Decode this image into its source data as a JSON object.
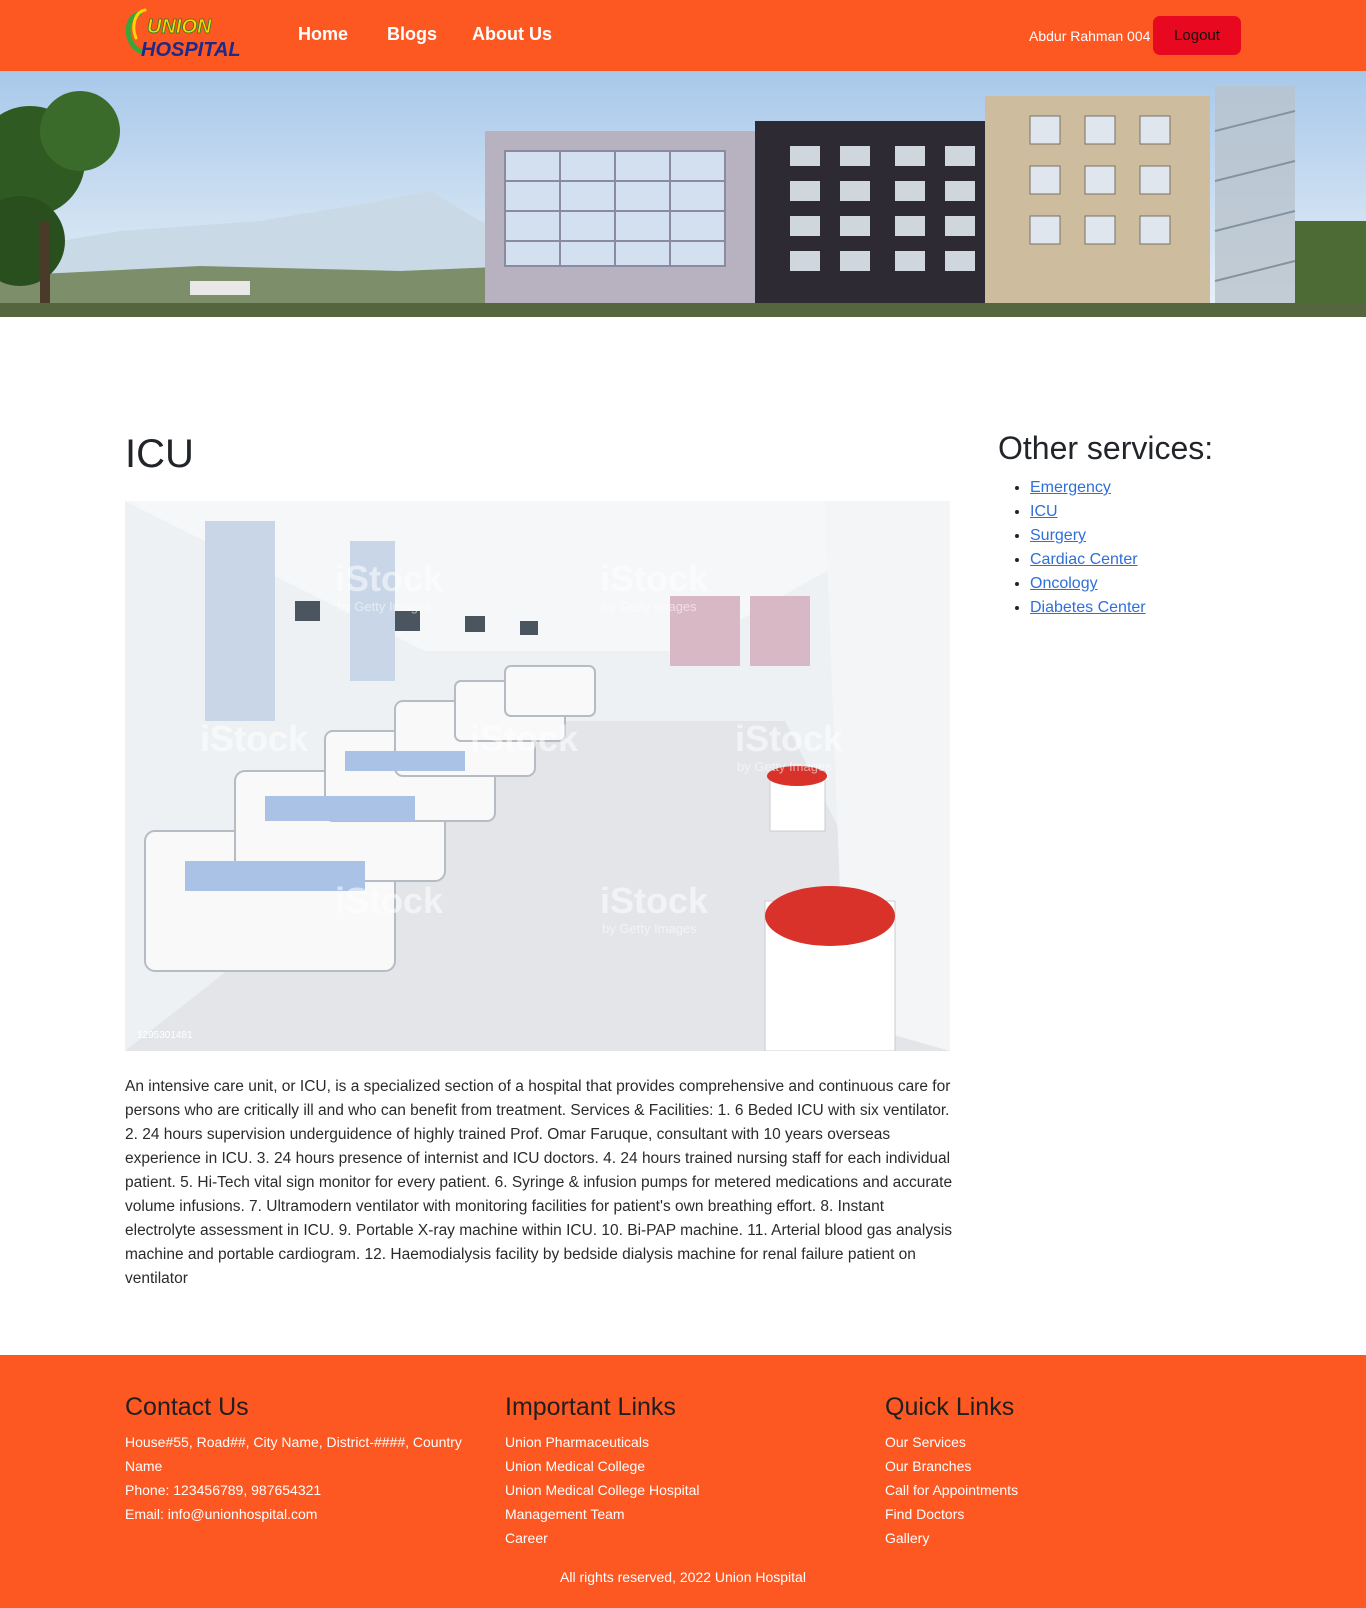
{
  "nav": {
    "logo_top": "UNION",
    "logo_bottom": "HOSPITAL",
    "links": [
      "Home",
      "Blogs",
      "About Us"
    ],
    "user_name": "Abdur Rahman 004",
    "logout_label": "Logout"
  },
  "main": {
    "title": "ICU",
    "image_watermark": "iStock",
    "image_watermark_sub": "by Getty Images",
    "image_id": "1295301481",
    "description": "An intensive care unit, or ICU, is a specialized section of a hospital that provides comprehensive and continuous care for persons who are critically ill and who can benefit from treatment. Services & Facilities: 1. 6 Beded ICU with six ventilator. 2. 24 hours supervision underguidence of highly trained Prof. Omar Faruque, consultant with 10 years overseas experience in ICU. 3. 24 hours presence of internist and ICU doctors. 4. 24 hours trained nursing staff for each individual patient. 5. Hi-Tech vital sign monitor for every patient. 6. Syringe & infusion pumps for metered medications and accurate volume infusions. 7. Ultramodern ventilator with monitoring facilities for patient's own breathing effort. 8. Instant electrolyte assessment in ICU. 9. Portable X-ray machine within ICU. 10. Bi-PAP machine. 11. Arterial blood gas analysis machine and portable cardiogram. 12. Haemodialysis facility by bedside dialysis machine for renal failure patient on ventilator"
  },
  "sidebar": {
    "title": "Other services:",
    "services": [
      "Emergency",
      "ICU",
      "Surgery",
      "Cardiac Center",
      "Oncology",
      "Diabetes Center"
    ]
  },
  "footer": {
    "contact": {
      "title": "Contact Us",
      "address": "House#55, Road##, City Name, District-####, Country Name",
      "phone": "Phone: 123456789, 987654321",
      "email": "Email: info@unionhospital.com"
    },
    "important": {
      "title": "Important Links",
      "links": [
        "Union Pharmaceuticals",
        "Union Medical College",
        "Union Medical College Hospital",
        "Management Team",
        "Career"
      ]
    },
    "quick": {
      "title": "Quick Links",
      "links": [
        "Our Services",
        "Our Branches",
        "Call for Appointments",
        "Find Doctors",
        "Gallery"
      ]
    },
    "copyright": "All rights reserved, 2022 Union Hospital"
  },
  "colors": {
    "brand_orange": "#fd5722",
    "logout_red": "#e8081f",
    "link_blue": "#2f6fd9"
  }
}
